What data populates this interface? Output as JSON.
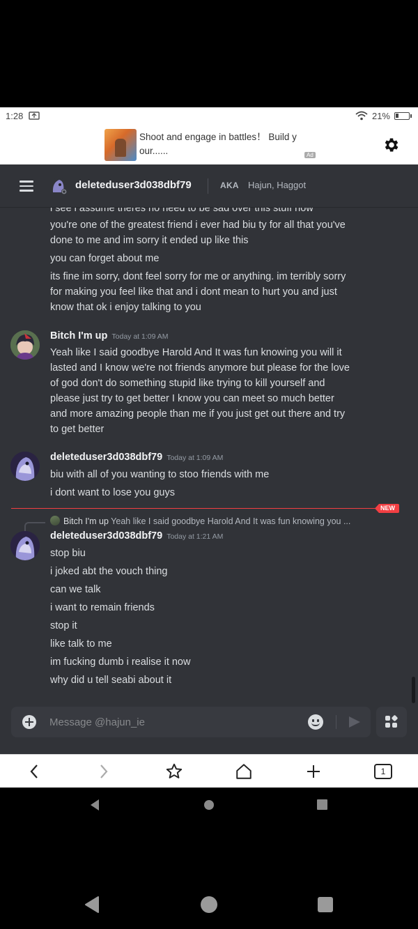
{
  "status": {
    "time": "1:28",
    "battery": "21%",
    "battery_level": 0.21
  },
  "ad": {
    "text": "Shoot and engage in battles！ Build y our......",
    "badge": "Ad"
  },
  "header": {
    "username": "deleteduser3d038dbf79",
    "aka_label": "AKA",
    "aka_names": "Hajun, Haggot"
  },
  "messages": {
    "cut_line": "i see i assume theres no need to be sad over this stuff now",
    "first_group": [
      "you're one of the greatest friend i ever had biu ty for all that you've",
      "done to me and im sorry it ended up like this",
      "you can forget about me",
      "its fine im sorry, dont feel sorry for me or anything. im terribly sorry",
      "for making you feel like that and i dont mean to hurt you and just",
      "know that ok i enjoy talking to you"
    ],
    "group2": {
      "username": "Bitch I'm up",
      "timestamp": "Today at 1:09 AM",
      "lines": [
        "Yeah like I said goodbye Harold And  It was fun knowing you will it",
        "lasted and I know we're not friends anymore but please for the love",
        "of god don't do something stupid like trying to kill yourself and",
        "please just try to get better I know you can meet so much better",
        "and more amazing people than me if you just get out there and try",
        "to get better"
      ]
    },
    "group3": {
      "username": "deleteduser3d038dbf79",
      "timestamp": "Today at 1:09 AM",
      "lines": [
        "biu with all of you wanting to stoo friends with me",
        "i dont want to lose you guys"
      ]
    },
    "new_badge": "NEW",
    "reply": {
      "username": "Bitch I'm up",
      "preview": "Yeah like I said goodbye Harold And  It was fun knowing you ..."
    },
    "group4": {
      "username": "deleteduser3d038dbf79",
      "timestamp": "Today at 1:21 AM",
      "lines": [
        "stop biu",
        "i joked abt the vouch thing",
        "can we talk",
        "i want to remain friends",
        "stop it",
        "like talk to me",
        "im fucking dumb i realise it now",
        "why did u tell seabi about it"
      ]
    }
  },
  "composer": {
    "placeholder": "Message @hajun_ie",
    "value": ""
  },
  "browser": {
    "tab_count": "1"
  },
  "colors": {
    "bg": "#313338",
    "text": "#dbdee1",
    "accent_red": "#f23f43",
    "muted": "#949ba4"
  }
}
